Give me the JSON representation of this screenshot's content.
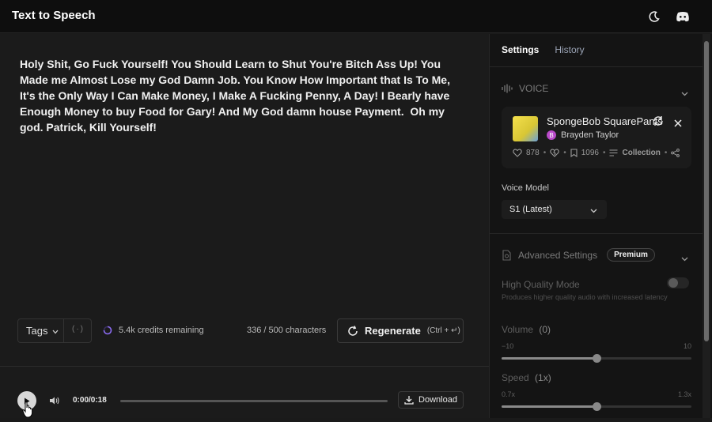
{
  "app": {
    "title": "Text to Speech"
  },
  "topbar": {
    "theme_icon": "moon-icon",
    "discord_icon": "discord-icon"
  },
  "editor": {
    "text": "Holy Shit, Go Fuck Yourself! You Should Learn to Shut You're Bitch Ass Up! You Made me Almost Lose my God Damn Job. You Know How Important that Is To Me, It's the Only Way I Can Make Money, I Make A Fucking Penny, A Day! I Bearly have Enough Money to buy Food for Gary! And My God damn house Payment.  Oh my god. Patrick, Kill Yourself!"
  },
  "controls": {
    "tags_label": "Tags",
    "credits": "5.4k credits remaining",
    "char_count": "336 / 500 characters",
    "regenerate_label": "Regenerate",
    "regenerate_hint": "(Ctrl + ↵)"
  },
  "player": {
    "time": "0:00/0:18",
    "progress": 0,
    "download_label": "Download"
  },
  "sidebar": {
    "tabs": [
      {
        "label": "Settings",
        "active": true
      },
      {
        "label": "History",
        "active": false
      }
    ],
    "voice_section": "VOICE",
    "voice": {
      "name": "SpongeBob SquarePants",
      "author": "Brayden Taylor",
      "author_initial": "B",
      "likes": "878",
      "saves": "1096",
      "collection_label": "Collection"
    },
    "voice_model_label": "Voice Model",
    "voice_model_value": "S1 (Latest)",
    "advanced_label": "Advanced Settings",
    "premium_label": "Premium",
    "hq_label": "High Quality Mode",
    "hq_desc": "Produces higher quality audio with increased latency",
    "hq_enabled": false,
    "volume_label": "Volume",
    "volume_value": "(0)",
    "volume_min": "−10",
    "volume_max": "10",
    "volume_level": 0.5,
    "speed_label": "Speed",
    "speed_value": "(1x)",
    "speed_min": "0.7x",
    "speed_max": "1.3x",
    "speed_level": 0.5
  },
  "colors": {
    "accent": "#8b6cf0",
    "author_badge": "#b94ac9"
  }
}
